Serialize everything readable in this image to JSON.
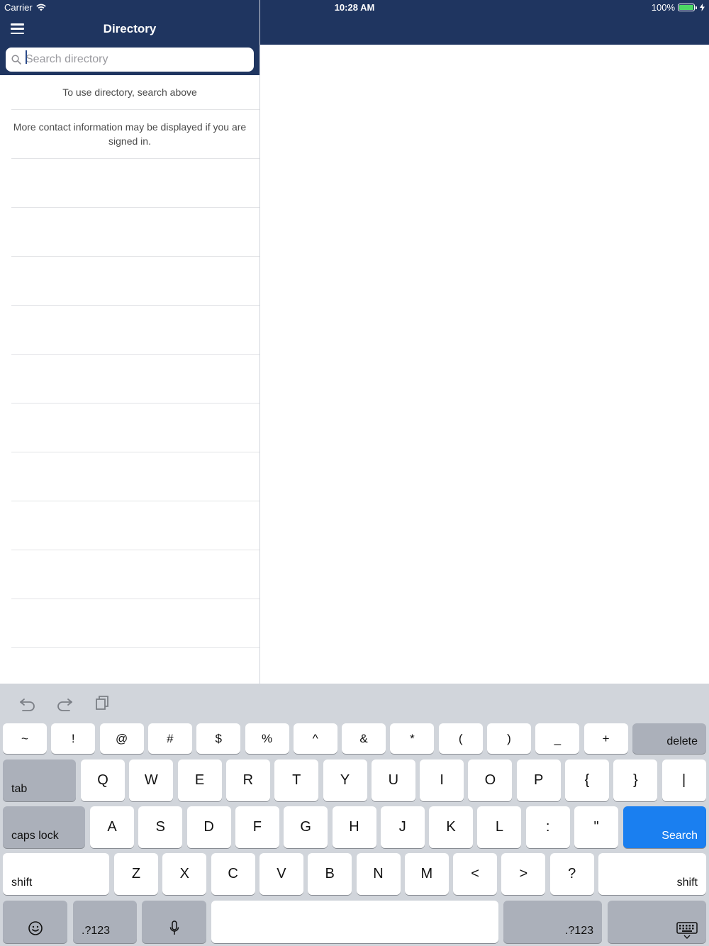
{
  "status": {
    "carrier": "Carrier",
    "time": "10:28 AM",
    "battery": "100%"
  },
  "nav": {
    "title": "Directory"
  },
  "search": {
    "placeholder": "Search directory",
    "value": ""
  },
  "list": {
    "hint": "To use directory, search above",
    "signin_note": "More contact information may be displayed if you are signed in."
  },
  "keyboard": {
    "row1": [
      "~",
      "!",
      "@",
      "#",
      "$",
      "%",
      "^",
      "&",
      "*",
      "(",
      ")",
      "_",
      "+"
    ],
    "delete": "delete",
    "tab": "tab",
    "row2": [
      "Q",
      "W",
      "E",
      "R",
      "T",
      "Y",
      "U",
      "I",
      "O",
      "P",
      "{",
      "}",
      "|"
    ],
    "caps": "caps lock",
    "row3": [
      "A",
      "S",
      "D",
      "F",
      "G",
      "H",
      "J",
      "K",
      "L",
      ":",
      "\""
    ],
    "search": "Search",
    "shift": "shift",
    "row4": [
      "Z",
      "X",
      "C",
      "V",
      "B",
      "N",
      "M",
      "<",
      ">",
      "?"
    ],
    "numbers_left": ".?123",
    "numbers_right": ".?123"
  },
  "colors": {
    "navy": "#1f3560",
    "keyboard_bg": "#d1d5db",
    "search_key": "#1a7ff0"
  }
}
